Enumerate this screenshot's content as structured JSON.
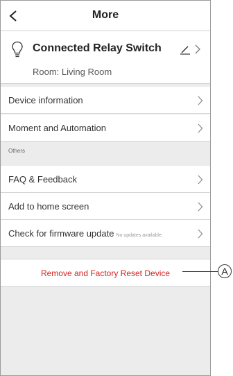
{
  "header": {
    "title": "More"
  },
  "device": {
    "name": "Connected Relay Switch",
    "room": "Room: Living Room"
  },
  "menu": {
    "device_information": "Device information",
    "moment_and_automation": "Moment and Automation",
    "others_section": "Others",
    "faq_feedback": "FAQ & Feedback",
    "add_to_home_screen": "Add to home screen",
    "firmware_update": "Check for firmware update",
    "firmware_status": "No updates available."
  },
  "remove": {
    "label": "Remove and Factory Reset Device"
  },
  "callout": {
    "label": "A"
  },
  "colors": {
    "accent_red": "#d42020",
    "background": "#ececec"
  },
  "icons": [
    "back-chevron-icon",
    "lightbulb-icon",
    "pencil-edit-icon",
    "chevron-right-icon"
  ]
}
